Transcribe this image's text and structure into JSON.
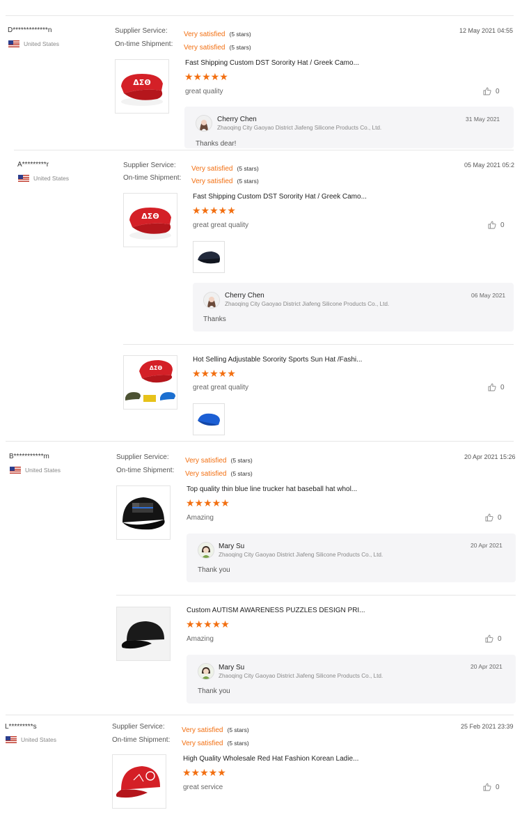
{
  "labels": {
    "supplier_service": "Supplier Service:",
    "ontime_shipment": "On-time Shipment:",
    "very_satisfied": "Very satisfied",
    "five_stars": "(5 stars)",
    "stars": "★★★★★"
  },
  "colors": {
    "accent": "#f26f11",
    "reply_bg": "#f5f5f7"
  },
  "reviews": [
    {
      "buyer": "D*************n",
      "country": "United States",
      "date": "12 May 2021 04:55",
      "items": [
        {
          "title": "Fast Shipping Custom DST Sorority Hat / Greek Camo...",
          "comment": "great quality",
          "likes": "0",
          "image": "red-visor-hat-image",
          "reply": {
            "name": "Cherry Chen",
            "company": "Zhaoqing City Gaoyao District Jiafeng Silicone Products Co., Ltd.",
            "date": "31 May 2021",
            "text": "Thanks dear!"
          }
        }
      ]
    },
    {
      "buyer": "A*********r",
      "country": "United States",
      "date": "05 May 2021 05:2",
      "items": [
        {
          "title": "Fast Shipping Custom DST Sorority Hat / Greek Camo...",
          "comment": "great great quality",
          "likes": "0",
          "image": "red-visor-hat-image",
          "reply": {
            "name": "Cherry Chen",
            "company": "Zhaoqing City Gaoyao District Jiafeng Silicone Products Co., Ltd.",
            "date": "06 May 2021",
            "text": "Thanks"
          }
        },
        {
          "title": "Hot Selling Adjustable Sorority Sports Sun Hat /Fashi...",
          "comment": "great great quality",
          "likes": "0",
          "image": "sorority-sun-visor-set-image"
        }
      ]
    },
    {
      "buyer": "B***********m",
      "country": "United States",
      "date": "20 Apr 2021 15:26",
      "items": [
        {
          "title": "Top quality thin blue line trucker hat baseball hat whol...",
          "comment": "Amazing",
          "likes": "0",
          "image": "black-thin-blue-line-cap-image",
          "reply": {
            "name": "Mary Su",
            "company": "Zhaoqing City Gaoyao District Jiafeng Silicone Products Co., Ltd.",
            "date": "20 Apr 2021",
            "text": "Thank you"
          }
        },
        {
          "title": "Custom AUTISM AWARENESS PUZZLES DESIGN PRI...",
          "comment": "Amazing",
          "likes": "0",
          "image": "black-baseball-cap-image",
          "reply": {
            "name": "Mary Su",
            "company": "Zhaoqing City Gaoyao District Jiafeng Silicone Products Co., Ltd.",
            "date": "20 Apr 2021",
            "text": "Thank you"
          }
        }
      ]
    },
    {
      "buyer": "L*********s",
      "country": "United States",
      "date": "25 Feb 2021 23:39",
      "items": [
        {
          "title": "High Quality Wholesale Red Hat Fashion Korean Ladie...",
          "comment": "great service",
          "likes": "0",
          "image": "red-baseball-cap-image"
        }
      ]
    }
  ]
}
